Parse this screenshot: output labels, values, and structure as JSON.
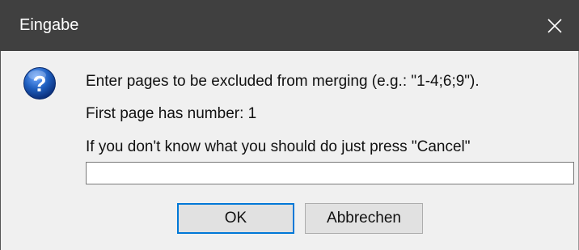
{
  "window": {
    "title": "Eingabe"
  },
  "message": {
    "line1": "Enter pages to be excluded from merging (e.g.: \"1-4;6;9\").",
    "line2": "First page has number: 1",
    "line3": "If you don't know what you should do just press \"Cancel\""
  },
  "input": {
    "value": ""
  },
  "buttons": {
    "ok_label": "OK",
    "cancel_label": "Abbrechen"
  },
  "icons": {
    "close": "close-icon",
    "question": "question-icon"
  },
  "colors": {
    "titlebar": "#404040",
    "accent": "#0078d7",
    "dialog_bg": "#f0f0f0",
    "question_icon": "#1f5fbf"
  }
}
